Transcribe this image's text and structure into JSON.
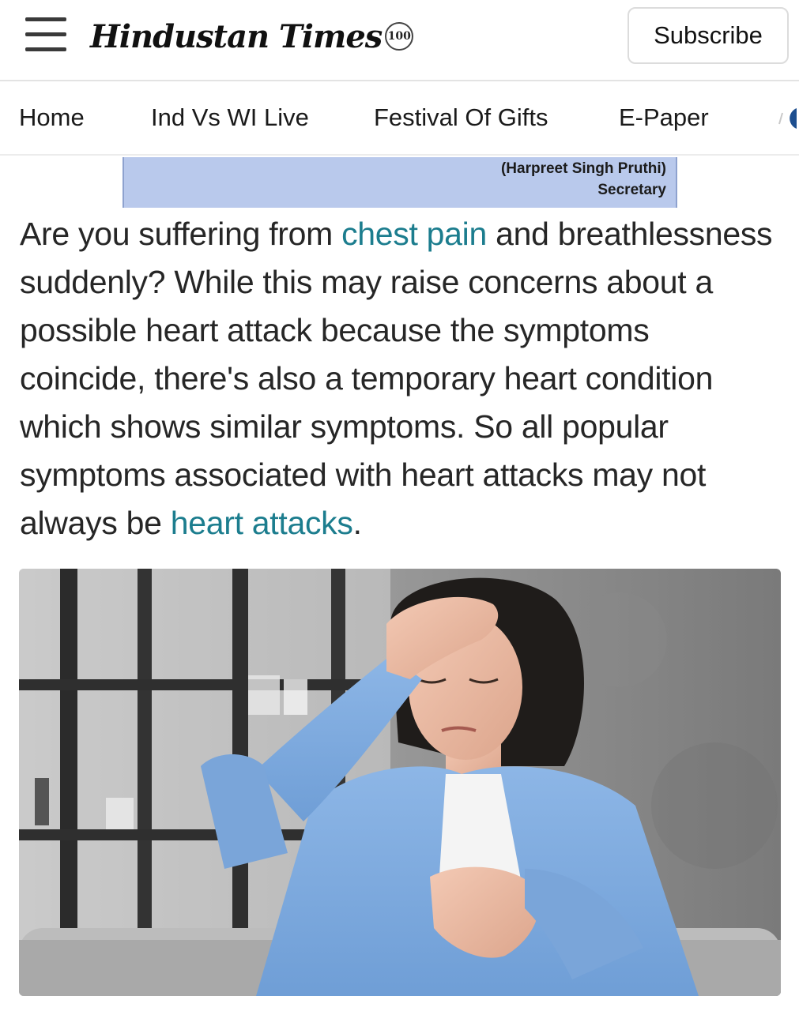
{
  "header": {
    "logo_text": "Hindustan Times",
    "logo_badge": "100",
    "subscribe_label": "Subscribe"
  },
  "nav": {
    "items": [
      {
        "label": "Home"
      },
      {
        "label": "Ind Vs WI Live"
      },
      {
        "label": "Festival Of Gifts"
      },
      {
        "label": "E-Paper"
      }
    ]
  },
  "ad": {
    "line1": "(Harpreet Singh Pruthi)",
    "line2": "Secretary"
  },
  "article": {
    "text_1": "Are you suffering from ",
    "link_1": "chest pain",
    "text_2": " and breathlessness suddenly? While this may raise concerns about a possible heart attack because the symptoms coincide, there's also a temporary heart condition which shows similar symptoms. So all popular symptoms associated with heart attacks may not always be ",
    "link_2": "heart attacks",
    "text_3": "."
  },
  "colors": {
    "link": "#1c7d8e",
    "ad_background": "#b9c9ec",
    "shirt": "#7ea9dc",
    "wall": "#8c8c8c"
  }
}
